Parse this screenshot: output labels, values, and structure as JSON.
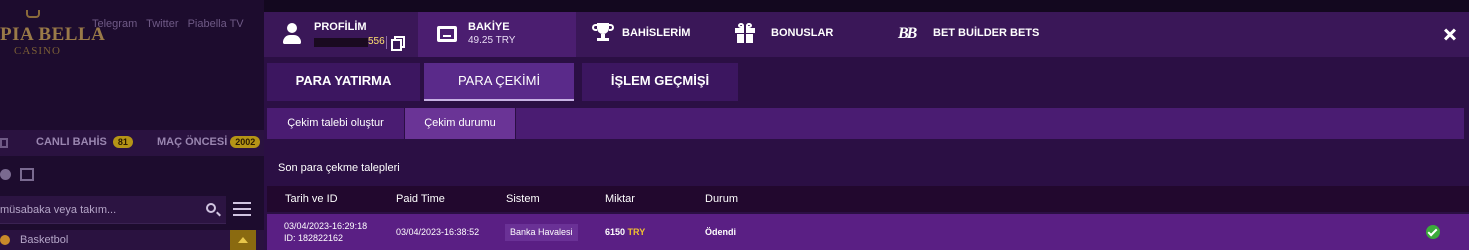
{
  "site": {
    "logo_line1": "PIA BELLA",
    "logo_line2": "CASINO",
    "social": [
      "Telegram",
      "Twitter",
      "Piabella TV"
    ],
    "tabs": {
      "live": "CANLI BAHİS",
      "live_count": "81",
      "prematch": "MAÇ ÖNCESİ",
      "prematch_count": "2002"
    },
    "search_placeholder": "müsabaka veya takım...",
    "sport": "Basketbol"
  },
  "modal": {
    "tabs": {
      "profile_label": "PROFİLİM",
      "profile_id_tail": "556",
      "balance_label": "BAKİYE",
      "balance_value": "49.25 TRY",
      "bets_label": "BAHİSLERİM",
      "bonuses_label": "BONUSLAR",
      "builder_label": "BET BUİLDER BETS",
      "builder_icon_text": "BB"
    },
    "subnav": {
      "deposit": "PARA YATIRMA",
      "withdraw": "PARA ÇEKİMİ",
      "history": "İŞLEM GEÇMİŞİ"
    },
    "subsubnav": {
      "create": "Çekim talebi oluştur",
      "status": "Çekim durumu"
    },
    "section_title": "Son para çekme talepleri",
    "table": {
      "headers": [
        "Tarih ve ID",
        "Paid Time",
        "Sistem",
        "Miktar",
        "Durum"
      ],
      "rows": [
        {
          "date": "03/04/2023-16:29:18",
          "id": "ID: 182822162",
          "paid_time": "03/04/2023-16:38:52",
          "system": "Banka Havalesi",
          "amount": "6150",
          "currency": "TRY",
          "status": "Ödendi"
        }
      ]
    }
  },
  "colors": {
    "modal_bg": "#2b0f44",
    "accent_gold": "#f2c230",
    "status_ok": "#3caa3c"
  },
  "icons": [
    "user-icon",
    "copy-icon",
    "wallet-icon",
    "trophy-icon",
    "gift-icon",
    "bet-builder-icon",
    "close-icon",
    "check-icon",
    "search-icon",
    "menu-icon"
  ]
}
